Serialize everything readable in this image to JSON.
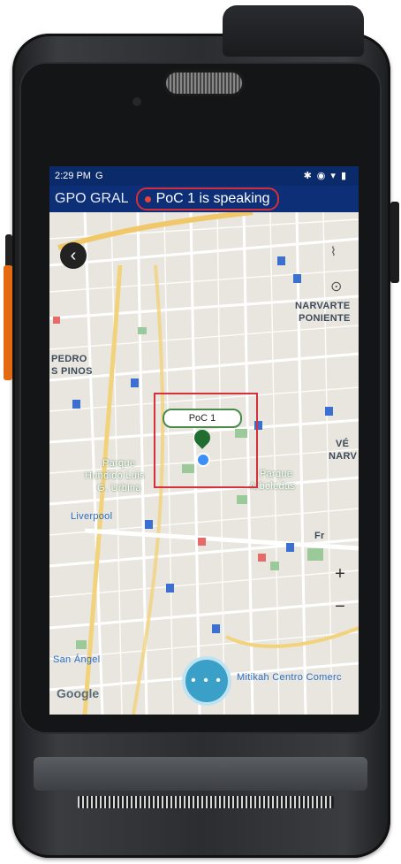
{
  "status_bar": {
    "time": "2:29 PM",
    "left_icons": "G",
    "right_icons": [
      "bluetooth-icon",
      "location-icon",
      "wifi-icon",
      "battery-icon"
    ]
  },
  "poc": {
    "group_name": "GPO GRAL",
    "speaking_text": "PoC 1  is speaking",
    "speaking_dot_color": "#e8423b",
    "highlight_color": "#d72f3c"
  },
  "map": {
    "labels": {
      "narvarte_poniente_1": "NARVARTE",
      "narvarte_poniente_2": "PONIENTE",
      "pedro_1": "PEDRO",
      "pedro_2": "S PINOS",
      "parque_hundido_1": "Parque",
      "parque_hundido_2": "Hundido Luis",
      "parque_hundido_3": "G. Urbina",
      "parque_arboledas_1": "Parque",
      "parque_arboledas_2": "Arboledas",
      "liverpool": "Liverpool",
      "san_angel": "San Ángel",
      "mitikah": "Mitikah Centro Comerc",
      "vertiz_1": "VÉ",
      "vertiz_2": "NARV",
      "fr": "Fr"
    },
    "user_marker_label": "PoC 1",
    "google": "Google",
    "zoom_in": "+",
    "zoom_out": "−"
  },
  "controls": {
    "back_glyph": "‹",
    "menu_glyph": "• • •"
  }
}
